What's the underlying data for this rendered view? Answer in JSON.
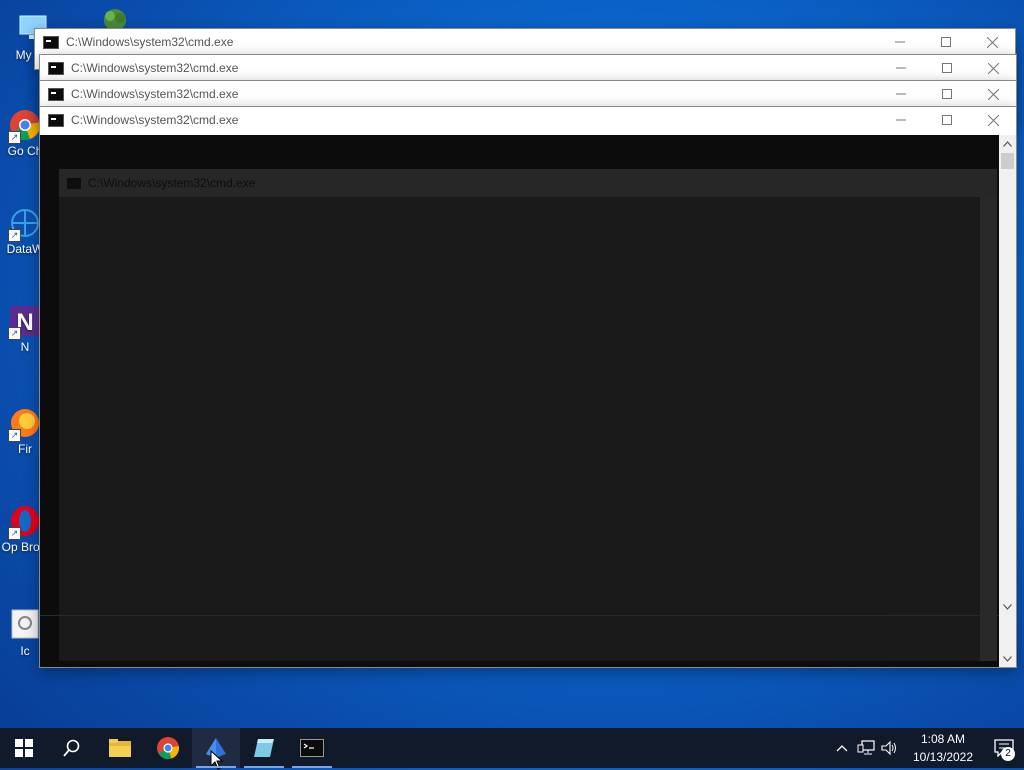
{
  "desktop": {
    "icons": [
      {
        "label": "My Co",
        "name": "my-computer"
      },
      {
        "label": "Go Ch",
        "name": "google-chrome"
      },
      {
        "label": "DataW",
        "name": "datawrapper"
      },
      {
        "label": "N",
        "name": "n-app"
      },
      {
        "label": "Fir",
        "name": "firefox"
      },
      {
        "label": "Op Brow",
        "name": "opera-browser"
      },
      {
        "label": "Ic",
        "name": "ic-app"
      }
    ]
  },
  "windows": [
    {
      "title": "C:\\Windows\\system32\\cmd.exe"
    },
    {
      "title": "C:\\Windows\\system32\\cmd.exe"
    },
    {
      "title": "C:\\Windows\\system32\\cmd.exe"
    },
    {
      "title": "C:\\Windows\\system32\\cmd.exe"
    }
  ],
  "ghost_window": {
    "title": "C:\\Windows\\system32\\cmd.exe"
  },
  "taskbar": {
    "apps": [
      "start",
      "search",
      "file-explorer",
      "chrome",
      "pinned-app",
      "notepad-app",
      "cmd"
    ],
    "clock": {
      "time": "1:08 AM",
      "date": "10/13/2022"
    },
    "notification_count": "2"
  },
  "colors": {
    "console_bg": "#0c0c0c",
    "taskbar_bg": "#101a2a",
    "desktop_blue": "#0a63c9"
  }
}
